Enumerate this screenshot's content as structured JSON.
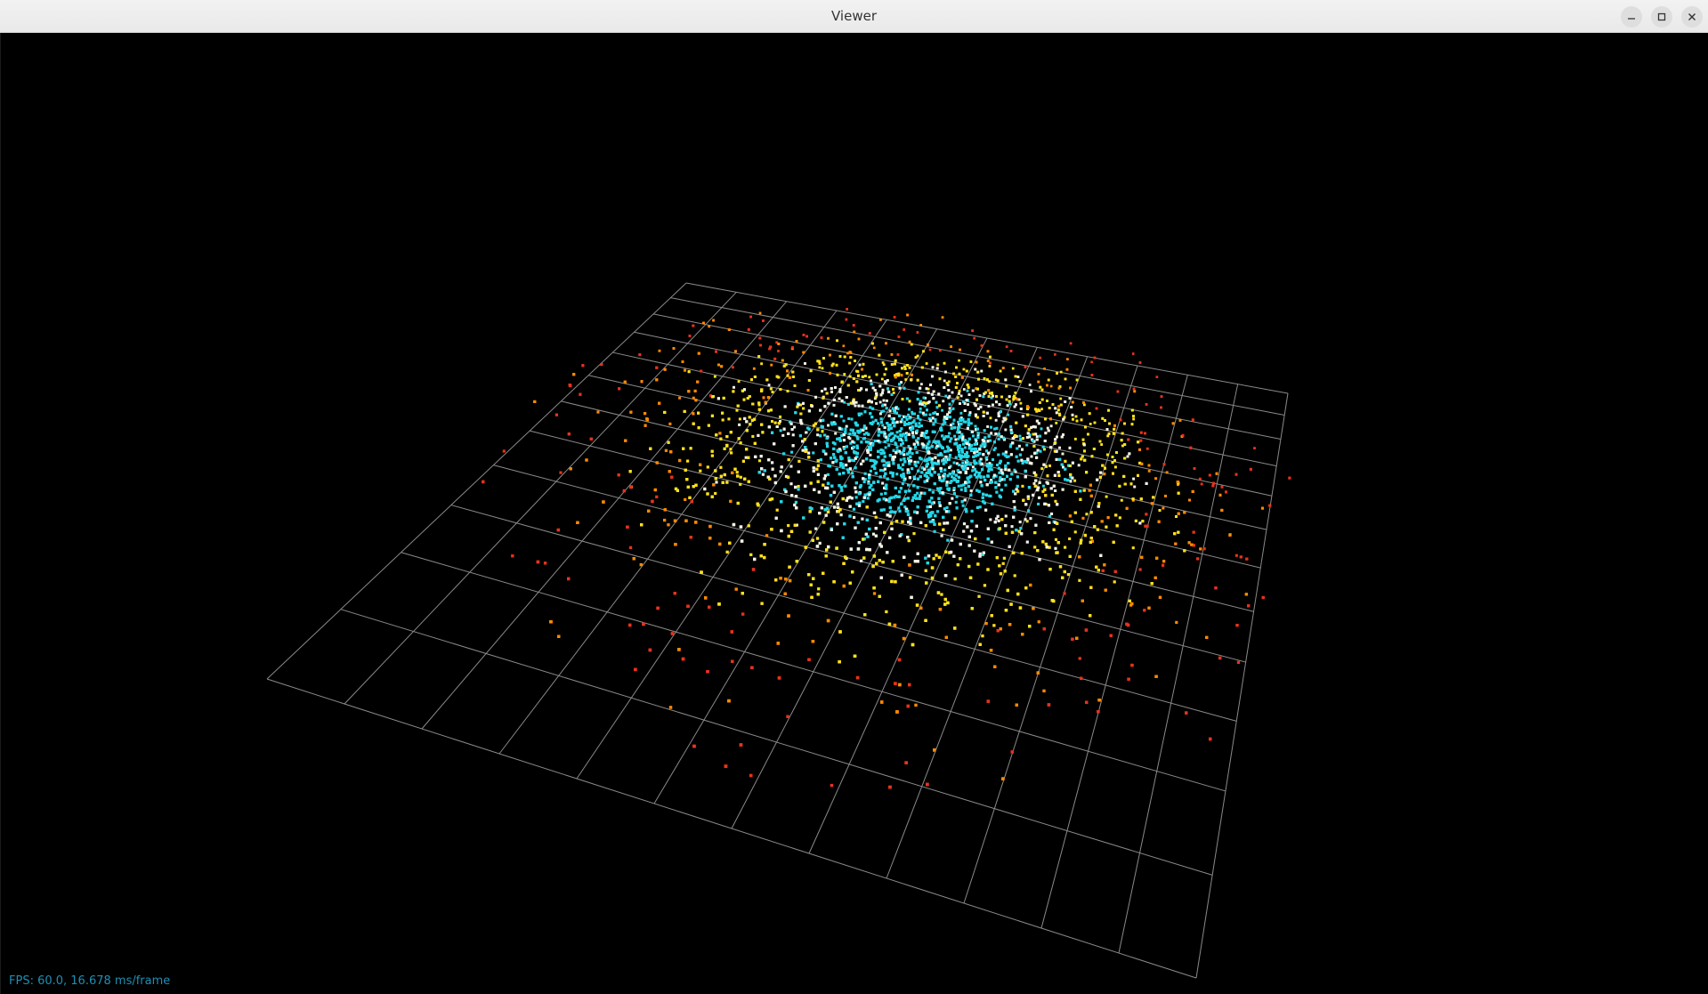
{
  "window": {
    "title": "Viewer",
    "controls": {
      "minimize": "minimize-icon",
      "maximize": "maximize-icon",
      "close": "close-icon"
    }
  },
  "viewport": {
    "background": "#000000",
    "grid": {
      "color": "#8a8a8a",
      "divisions": 12
    },
    "point_cloud": {
      "colormap": [
        "#e8321c",
        "#ff8a00",
        "#ffe21a",
        "#f2f2e6",
        "#23d8e8"
      ],
      "description_colors_center_to_edge": [
        "cyan",
        "white",
        "yellow",
        "orange",
        "red"
      ]
    }
  },
  "status": {
    "fps_text": "FPS: 60.0, 16.678 ms/frame"
  }
}
